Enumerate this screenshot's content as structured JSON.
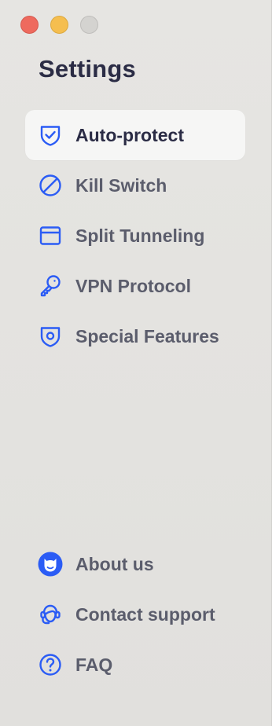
{
  "window": {
    "title": "Settings"
  },
  "accent_color": "#2b5cf5",
  "nav": {
    "main": [
      {
        "label": "Auto-protect",
        "icon": "shield-check-icon",
        "active": true
      },
      {
        "label": "Kill Switch",
        "icon": "prohibited-icon",
        "active": false
      },
      {
        "label": "Split Tunneling",
        "icon": "window-split-icon",
        "active": false
      },
      {
        "label": "VPN Protocol",
        "icon": "key-icon",
        "active": false
      },
      {
        "label": "Special Features",
        "icon": "shield-dot-icon",
        "active": false
      }
    ],
    "footer": [
      {
        "label": "About us",
        "icon": "mascot-face-icon"
      },
      {
        "label": "Contact support",
        "icon": "headset-agent-icon"
      },
      {
        "label": "FAQ",
        "icon": "question-circle-icon"
      }
    ]
  }
}
